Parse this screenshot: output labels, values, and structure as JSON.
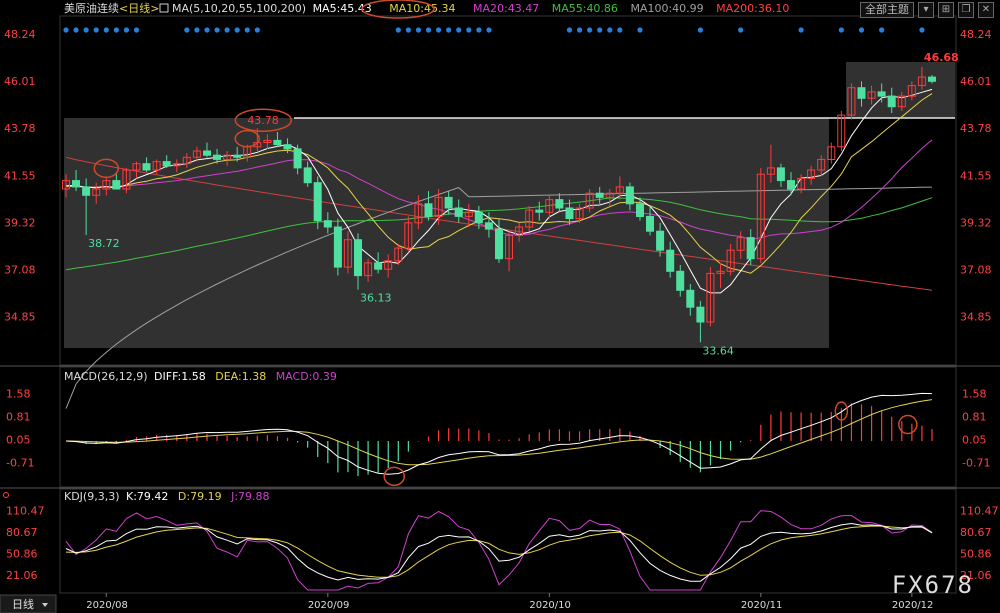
{
  "toolbar": {
    "main_chart_label": "全部主题"
  },
  "main_header": {
    "symbol": "美原油连续",
    "period_tag": "<日线>",
    "ma_label": "MA(5,10,20,55,100,200)",
    "ma5": "MA5:45.43",
    "ma10": "MA10:45.34",
    "ma20": "MA20:43.47",
    "ma55": "MA55:40.86",
    "ma100": "MA100:40.99",
    "ma200": "MA200:36.10"
  },
  "macd_header": {
    "label": "MACD(26,12,9)",
    "diff": "DIFF:1.58",
    "dea": "DEA:1.38",
    "macd": "MACD:0.39"
  },
  "kdj_header": {
    "label": "KDJ(9,3,3)",
    "k": "K:79.42",
    "d": "D:79.19",
    "j": "J:79.88"
  },
  "bottom": {
    "period_button": "日线"
  },
  "watermark": "FX678",
  "colors": {
    "up": "#ff3a3a",
    "down": "#4fe0a0",
    "ma5": "#ffffff",
    "ma10": "#e5d34a",
    "ma20": "#d040d0",
    "ma55": "#40c040",
    "ma100": "#a0a0a0",
    "ma200": "#d04040",
    "axis_text": "#ff4040"
  },
  "chart_data": [
    {
      "type": "candlestick",
      "title": "美原油连续<日线>",
      "y_ticks": [
        "48.24",
        "46.01",
        "43.78",
        "41.55",
        "39.32",
        "37.08",
        "34.85"
      ],
      "x_ticks": [
        "2020/08",
        "2020/09",
        "2020/10",
        "2020/11",
        "2020/12"
      ],
      "annotations": [
        "43.78",
        "46.68",
        "38.72",
        "36.13",
        "33.64"
      ],
      "ylim": [
        32.8,
        49.0
      ],
      "series": [
        {
          "name": "MA5",
          "last": 45.43
        },
        {
          "name": "MA10",
          "last": 45.34
        },
        {
          "name": "MA20",
          "last": 43.47
        },
        {
          "name": "MA55",
          "last": 40.86
        },
        {
          "name": "MA100",
          "last": 40.99
        },
        {
          "name": "MA200",
          "last": 36.1
        }
      ],
      "ohlc": [
        [
          40.9,
          41.6,
          40.5,
          41.3
        ],
        [
          41.3,
          41.8,
          40.8,
          41.0
        ],
        [
          41.0,
          41.4,
          38.72,
          40.6
        ],
        [
          40.6,
          41.2,
          40.2,
          40.9
        ],
        [
          40.9,
          41.5,
          40.6,
          41.3
        ],
        [
          41.3,
          41.7,
          41.0,
          40.9
        ],
        [
          40.9,
          41.9,
          40.7,
          41.8
        ],
        [
          41.8,
          42.2,
          41.4,
          42.1
        ],
        [
          42.1,
          42.4,
          41.7,
          41.8
        ],
        [
          41.8,
          42.3,
          41.6,
          42.2
        ],
        [
          42.2,
          42.5,
          41.9,
          42.0
        ],
        [
          42.0,
          42.3,
          41.7,
          42.1
        ],
        [
          42.1,
          42.6,
          41.9,
          42.4
        ],
        [
          42.4,
          42.9,
          42.2,
          42.7
        ],
        [
          42.7,
          43.1,
          42.4,
          42.5
        ],
        [
          42.5,
          42.8,
          42.1,
          42.3
        ],
        [
          42.3,
          42.7,
          42.0,
          42.5
        ],
        [
          42.5,
          42.9,
          42.2,
          42.4
        ],
        [
          42.4,
          43.0,
          42.2,
          42.9
        ],
        [
          42.9,
          43.78,
          42.7,
          43.1
        ],
        [
          43.1,
          43.5,
          42.8,
          43.2
        ],
        [
          43.2,
          43.6,
          42.9,
          43.0
        ],
        [
          43.0,
          43.3,
          42.6,
          42.8
        ],
        [
          42.8,
          43.0,
          41.6,
          41.9
        ],
        [
          41.9,
          42.2,
          41.0,
          41.2
        ],
        [
          41.2,
          41.5,
          39.0,
          39.4
        ],
        [
          39.4,
          39.8,
          38.8,
          39.1
        ],
        [
          39.1,
          39.5,
          36.8,
          37.2
        ],
        [
          37.2,
          38.9,
          36.9,
          38.5
        ],
        [
          38.5,
          38.8,
          36.13,
          36.8
        ],
        [
          36.8,
          37.6,
          36.5,
          37.4
        ],
        [
          37.4,
          37.9,
          36.9,
          37.1
        ],
        [
          37.1,
          37.8,
          36.7,
          37.5
        ],
        [
          37.5,
          38.3,
          37.3,
          38.1
        ],
        [
          38.1,
          39.6,
          37.9,
          39.3
        ],
        [
          39.3,
          40.6,
          39.0,
          40.2
        ],
        [
          40.2,
          40.8,
          39.4,
          39.6
        ],
        [
          39.6,
          40.9,
          39.2,
          40.5
        ],
        [
          40.5,
          40.8,
          39.7,
          40.0
        ],
        [
          40.0,
          40.4,
          39.3,
          39.6
        ],
        [
          39.6,
          40.2,
          39.1,
          39.8
        ],
        [
          39.8,
          40.1,
          39.0,
          39.3
        ],
        [
          39.3,
          39.8,
          38.6,
          39.0
        ],
        [
          39.0,
          39.5,
          37.4,
          37.6
        ],
        [
          37.6,
          38.9,
          37.0,
          38.7
        ],
        [
          38.7,
          39.3,
          38.4,
          39.1
        ],
        [
          39.1,
          40.1,
          38.9,
          39.9
        ],
        [
          39.9,
          40.3,
          39.4,
          39.8
        ],
        [
          39.8,
          40.6,
          39.5,
          40.4
        ],
        [
          40.4,
          40.7,
          39.8,
          40.0
        ],
        [
          40.0,
          40.4,
          39.2,
          39.5
        ],
        [
          39.5,
          40.2,
          39.3,
          40.0
        ],
        [
          40.0,
          40.9,
          39.8,
          40.7
        ],
        [
          40.7,
          41.0,
          40.2,
          40.5
        ],
        [
          40.5,
          40.9,
          40.1,
          40.7
        ],
        [
          40.7,
          41.5,
          40.4,
          41.0
        ],
        [
          41.0,
          41.2,
          39.9,
          40.2
        ],
        [
          40.2,
          40.5,
          39.4,
          39.6
        ],
        [
          39.6,
          40.1,
          38.7,
          38.9
        ],
        [
          38.9,
          39.3,
          37.7,
          38.0
        ],
        [
          38.0,
          38.4,
          36.7,
          37.0
        ],
        [
          37.0,
          37.3,
          35.8,
          36.1
        ],
        [
          36.1,
          36.4,
          34.9,
          35.3
        ],
        [
          35.3,
          35.6,
          33.64,
          34.6
        ],
        [
          34.6,
          37.2,
          34.4,
          36.9
        ],
        [
          36.9,
          37.4,
          36.2,
          37.0
        ],
        [
          37.0,
          38.3,
          36.8,
          38.0
        ],
        [
          38.0,
          38.9,
          37.6,
          38.6
        ],
        [
          38.6,
          39.0,
          37.3,
          37.6
        ],
        [
          37.6,
          41.9,
          37.4,
          41.6
        ],
        [
          41.6,
          43.0,
          41.2,
          41.9
        ],
        [
          41.9,
          42.1,
          41.0,
          41.3
        ],
        [
          41.3,
          41.7,
          40.6,
          40.9
        ],
        [
          40.9,
          41.6,
          40.7,
          41.4
        ],
        [
          41.4,
          42.0,
          41.1,
          41.8
        ],
        [
          41.8,
          42.5,
          41.5,
          42.3
        ],
        [
          42.3,
          43.1,
          42.1,
          42.9
        ],
        [
          42.9,
          44.6,
          42.7,
          44.4
        ],
        [
          44.4,
          45.9,
          44.2,
          45.7
        ],
        [
          45.7,
          46.0,
          44.8,
          45.2
        ],
        [
          45.2,
          45.8,
          44.9,
          45.5
        ],
        [
          45.5,
          45.9,
          45.0,
          45.3
        ],
        [
          45.3,
          45.7,
          44.5,
          44.8
        ],
        [
          44.8,
          45.5,
          44.6,
          45.3
        ],
        [
          45.3,
          46.0,
          45.1,
          45.8
        ],
        [
          45.8,
          46.68,
          45.6,
          46.2
        ],
        [
          46.2,
          46.3,
          45.9,
          46.0
        ]
      ]
    },
    {
      "type": "line",
      "title": "MACD(26,12,9)",
      "y_ticks": [
        "1.58",
        "0.81",
        "0.05",
        "-0.71"
      ],
      "ylim": [
        -1.5,
        2.1
      ],
      "series": [
        {
          "name": "DIFF",
          "last": 1.58
        },
        {
          "name": "DEA",
          "last": 1.38
        },
        {
          "name": "MACD",
          "last": 0.39
        }
      ]
    },
    {
      "type": "line",
      "title": "KDJ(9,3,3)",
      "y_ticks": [
        "110.47",
        "80.67",
        "50.86",
        "21.06"
      ],
      "ylim": [
        0,
        122
      ],
      "series": [
        {
          "name": "K",
          "last": 79.42
        },
        {
          "name": "D",
          "last": 79.19
        },
        {
          "name": "J",
          "last": 79.88
        }
      ]
    }
  ]
}
